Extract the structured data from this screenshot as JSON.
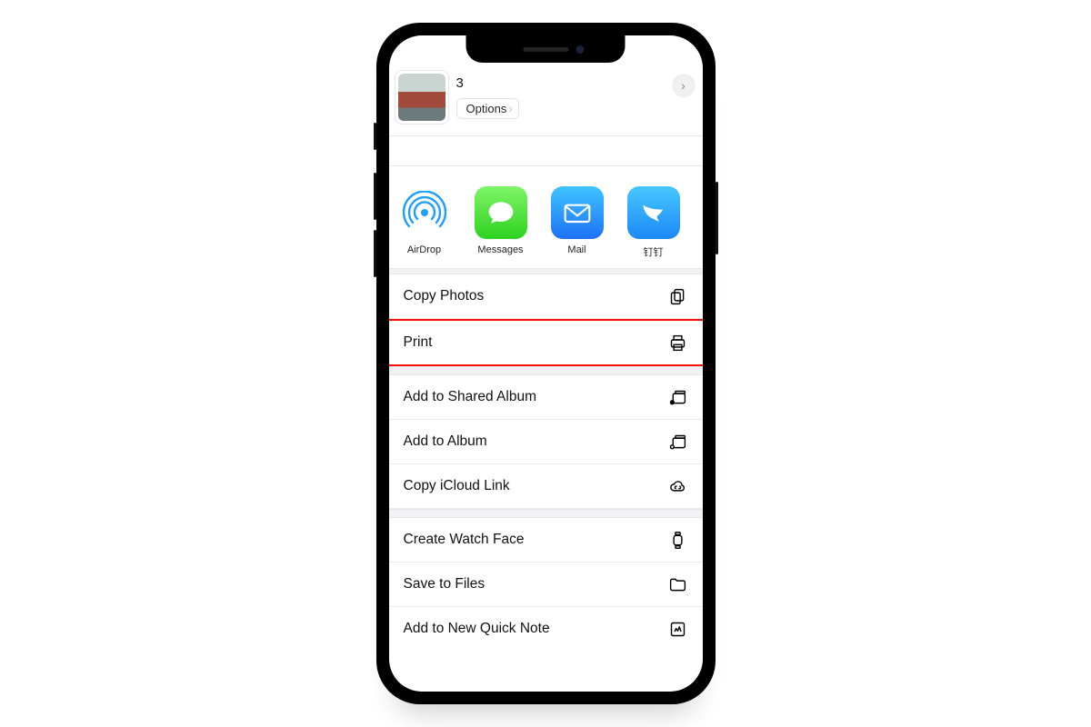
{
  "header": {
    "count_label": "3",
    "options_label": "Options"
  },
  "apps": [
    {
      "label": "AirDrop",
      "name": "airdrop"
    },
    {
      "label": "Messages",
      "name": "messages"
    },
    {
      "label": "Mail",
      "name": "mail"
    },
    {
      "label": "钉钉",
      "name": "dingtalk"
    }
  ],
  "actions": {
    "copy_photos": "Copy Photos",
    "print": "Print",
    "shared_album": "Add to Shared Album",
    "add_album": "Add to Album",
    "icloud_link": "Copy iCloud Link",
    "watch_face": "Create Watch Face",
    "save_files": "Save to Files",
    "quick_note": "Add to New Quick Note"
  }
}
